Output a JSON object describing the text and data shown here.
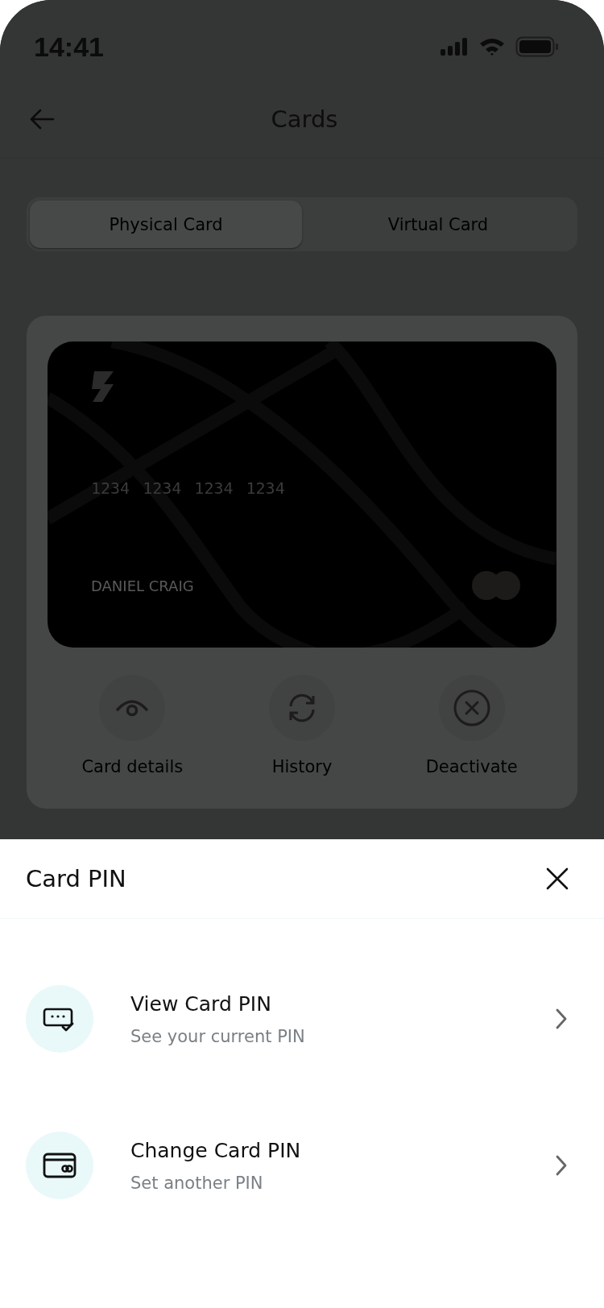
{
  "status_bar": {
    "time": "14:41"
  },
  "header": {
    "title": "Cards"
  },
  "tabs": [
    {
      "label": "Physical Card",
      "selected": true
    },
    {
      "label": "Virtual Card",
      "selected": false
    }
  ],
  "card": {
    "number_groups": [
      "1234",
      "1234",
      "1234",
      "1234"
    ],
    "holder": "DANIEL CRAIG"
  },
  "actions": [
    {
      "label": "Card details",
      "kind": "eye"
    },
    {
      "label": "History",
      "kind": "refresh"
    },
    {
      "label": "Deactivate",
      "kind": "cancel"
    }
  ],
  "sheet": {
    "title": "Card PIN",
    "options": [
      {
        "title": "View Card PIN",
        "subtitle": "See your current PIN",
        "kind": "view"
      },
      {
        "title": "Change Card PIN",
        "subtitle": "Set another PIN",
        "kind": "change"
      }
    ]
  }
}
